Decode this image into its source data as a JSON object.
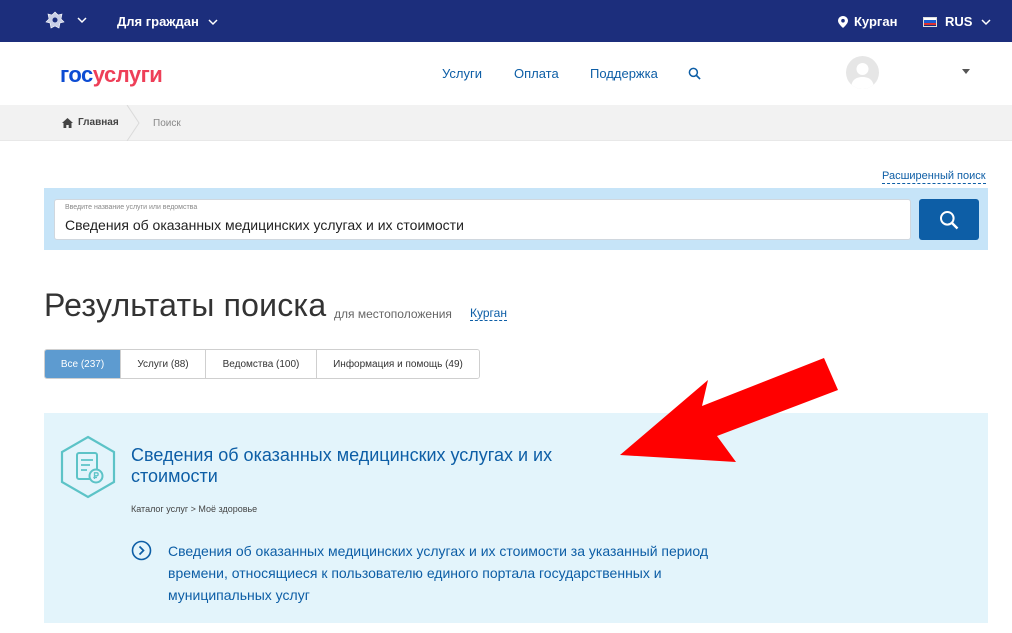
{
  "topbar": {
    "citizens_label": "Для граждан",
    "location": "Курган",
    "language": "RUS"
  },
  "header": {
    "logo_part1": "гос",
    "logo_part2": "услуги",
    "nav": [
      "Услуги",
      "Оплата",
      "Поддержка"
    ]
  },
  "breadcrumb": {
    "home": "Главная",
    "current": "Поиск"
  },
  "search": {
    "advanced_link": "Расширенный поиск",
    "placeholder": "Введите название услуги или ведомства",
    "value": "Сведения об оказанных медицинских услугах и их стоимости"
  },
  "results": {
    "title": "Результаты поиска",
    "location_prefix": "для местоположения",
    "location_city": "Курган",
    "tabs": [
      {
        "label": "Все (237)",
        "active": true
      },
      {
        "label": "Услуги (88)",
        "active": false
      },
      {
        "label": "Ведомства (100)",
        "active": false
      },
      {
        "label": "Информация и помощь (49)",
        "active": false
      }
    ]
  },
  "card": {
    "title": "Сведения об оказанных медицинских услугах и их стоимости",
    "path": "Каталог услуг > Моё здоровье",
    "link": "Сведения об оказанных медицинских услугах и их стоимости за указанный период времени, относящиеся к пользователю единого портала государственных и муниципальных услуг"
  },
  "colors": {
    "topbar_bg": "#1c2e7c",
    "accent": "#0d5ea6",
    "logo_blue": "#0d4cd3",
    "logo_red": "#ee3f58",
    "card_bg": "#e3f4fb",
    "annotation_red": "#ff0000"
  },
  "icons": [
    "crest-icon",
    "chevron-down-icon",
    "location-pin-icon",
    "flag-ru-icon",
    "search-icon",
    "avatar-icon",
    "home-icon",
    "service-document-icon",
    "chevron-right-circle-icon",
    "red-arrow-annotation"
  ]
}
